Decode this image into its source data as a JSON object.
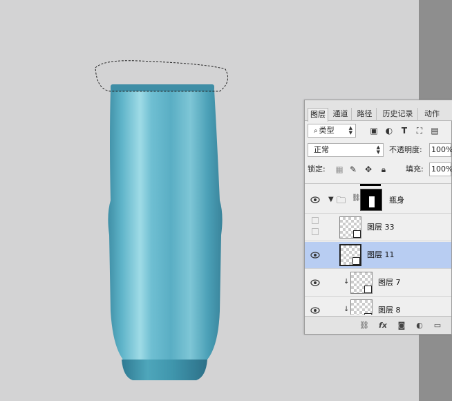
{
  "colors": {
    "canvas": "#d3d3d4",
    "panel": "#efefef",
    "selected": "#b8cdf2",
    "bottle": "#5fb0c4"
  },
  "tabs": [
    {
      "label": "图层",
      "active": true
    },
    {
      "label": "通道",
      "active": false
    },
    {
      "label": "路径",
      "active": false
    },
    {
      "label": "历史记录",
      "active": false
    },
    {
      "label": "动作",
      "active": false
    }
  ],
  "filter": {
    "kind_label": "类型"
  },
  "blend": {
    "mode": "正常",
    "opacity_label": "不透明度:",
    "opacity_value": "100%"
  },
  "lock": {
    "label": "锁定:",
    "fill_label": "填充:",
    "fill_value": "100%"
  },
  "layers": [
    {
      "name": "瓶身",
      "type": "group",
      "visible": true
    },
    {
      "name": "图层 33",
      "type": "smart",
      "visible": false
    },
    {
      "name": "图层 11",
      "type": "smart",
      "visible": true,
      "selected": true
    },
    {
      "name": "图层 7",
      "type": "smart",
      "visible": true,
      "clipped": true
    },
    {
      "name": "图层 8",
      "type": "smart",
      "visible": true,
      "clipped": true
    }
  ],
  "bottom_icons": [
    "link-icon",
    "fx-icon",
    "mask-icon",
    "adjustment-icon",
    "folder-icon"
  ],
  "fx_label": "fx"
}
